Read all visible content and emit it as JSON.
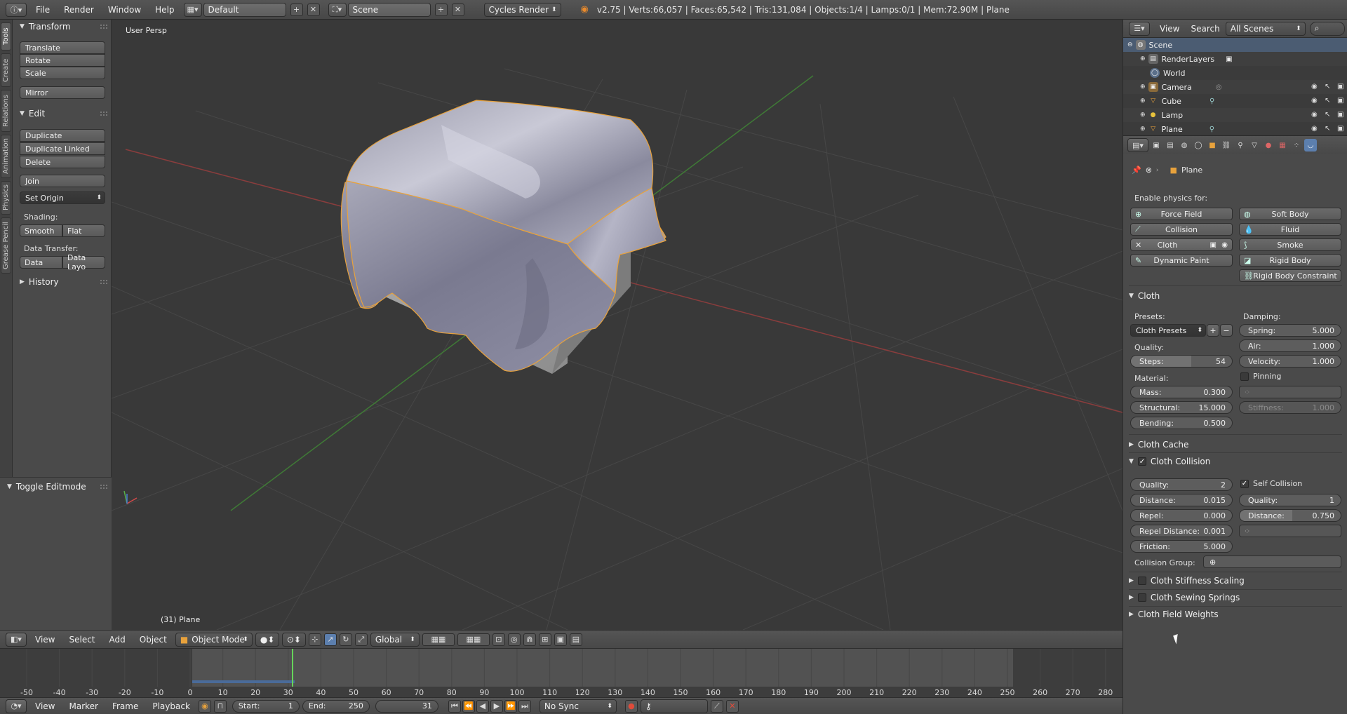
{
  "topbar": {
    "menus": [
      "File",
      "Render",
      "Window",
      "Help"
    ],
    "layout": "Default",
    "scene": "Scene",
    "engine": "Cycles Render",
    "stats": "v2.75 | Verts:66,057 | Faces:65,542 | Tris:131,084 | Objects:1/4 | Lamps:0/1 | Mem:72.90M | Plane"
  },
  "tooltabs": [
    "Tools",
    "Create",
    "Relations",
    "Animation",
    "Physics",
    "Grease Pencil"
  ],
  "toolshelf": {
    "transform_title": "Transform",
    "translate": "Translate",
    "rotate": "Rotate",
    "scale": "Scale",
    "mirror": "Mirror",
    "edit_title": "Edit",
    "duplicate": "Duplicate",
    "duplicate_linked": "Duplicate Linked",
    "delete": "Delete",
    "join": "Join",
    "set_origin": "Set Origin",
    "shading_label": "Shading:",
    "smooth": "Smooth",
    "flat": "Flat",
    "data_transfer_label": "Data Transfer:",
    "data": "Data",
    "data_layout": "Data Layo",
    "history_title": "History",
    "toggle_editmode": "Toggle Editmode"
  },
  "viewport": {
    "view_name": "User Persp",
    "object_info": "(31) Plane"
  },
  "viewport_header": {
    "menus": [
      "View",
      "Select",
      "Add",
      "Object"
    ],
    "mode": "Object Mode",
    "orientation": "Global"
  },
  "timeline": {
    "ticks": [
      "-50",
      "-40",
      "-30",
      "-20",
      "-10",
      "0",
      "10",
      "20",
      "30",
      "40",
      "50",
      "60",
      "70",
      "80",
      "90",
      "100",
      "110",
      "120",
      "130",
      "140",
      "150",
      "160",
      "170",
      "180",
      "190",
      "200",
      "210",
      "220",
      "230",
      "240",
      "250",
      "260",
      "270",
      "280"
    ],
    "menus": [
      "View",
      "Marker",
      "Frame",
      "Playback"
    ],
    "start_label": "Start:",
    "start_value": "1",
    "end_label": "End:",
    "end_value": "250",
    "current_frame": "31",
    "sync": "No Sync"
  },
  "outliner": {
    "menus": [
      "View",
      "Search"
    ],
    "scene_filter": "All Scenes",
    "rows": [
      "Scene",
      "RenderLayers",
      "World",
      "Camera",
      "Cube",
      "Lamp",
      "Plane"
    ]
  },
  "properties": {
    "context_object": "Plane",
    "enable_physics_label": "Enable physics for:",
    "buttons": {
      "force_field": "Force Field",
      "soft_body": "Soft Body",
      "collision": "Collision",
      "fluid": "Fluid",
      "cloth": "Cloth",
      "smoke": "Smoke",
      "dynamic_paint": "Dynamic Paint",
      "rigid_body": "Rigid Body",
      "rigid_body_constraint": "Rigid Body Constraint"
    },
    "cloth_title": "Cloth",
    "presets_label": "Presets:",
    "presets_value": "Cloth Presets",
    "quality_label": "Quality:",
    "steps_label": "Steps:",
    "steps_value": "54",
    "material_label": "Material:",
    "mass_label": "Mass:",
    "mass_value": "0.300",
    "structural_label": "Structural:",
    "structural_value": "15.000",
    "bending_label": "Bending:",
    "bending_value": "0.500",
    "damping_label": "Damping:",
    "spring_label": "Spring:",
    "spring_value": "5.000",
    "air_label": "Air:",
    "air_value": "1.000",
    "velocity_label": "Velocity:",
    "velocity_value": "1.000",
    "pinning_label": "Pinning",
    "stiffness_label": "Stiffness:",
    "stiffness_value": "1.000",
    "cloth_cache_title": "Cloth Cache",
    "cloth_collision_title": "Cloth Collision",
    "col_quality_label": "Quality:",
    "col_quality_value": "2",
    "distance_label": "Distance:",
    "distance_value": "0.015",
    "repel_label": "Repel:",
    "repel_value": "0.000",
    "repel_distance_label": "Repel Distance:",
    "repel_distance_value": "0.001",
    "friction_label": "Friction:",
    "friction_value": "5.000",
    "self_collision_label": "Self Collision",
    "self_quality_label": "Quality:",
    "self_quality_value": "1",
    "self_distance_label": "Distance:",
    "self_distance_value": "0.750",
    "collision_group_label": "Collision Group:",
    "stiffness_scaling_title": "Cloth Stiffness Scaling",
    "sewing_springs_title": "Cloth Sewing Springs",
    "field_weights_title": "Cloth Field Weights"
  },
  "colors": {
    "background": "#393939",
    "panel": "#4a4a4a",
    "selection_outline": "#e8a23c",
    "active_tab": "#5c7fae",
    "x_axis": "#b84a4a",
    "y_axis": "#55a845",
    "playhead": "#66d45a"
  }
}
